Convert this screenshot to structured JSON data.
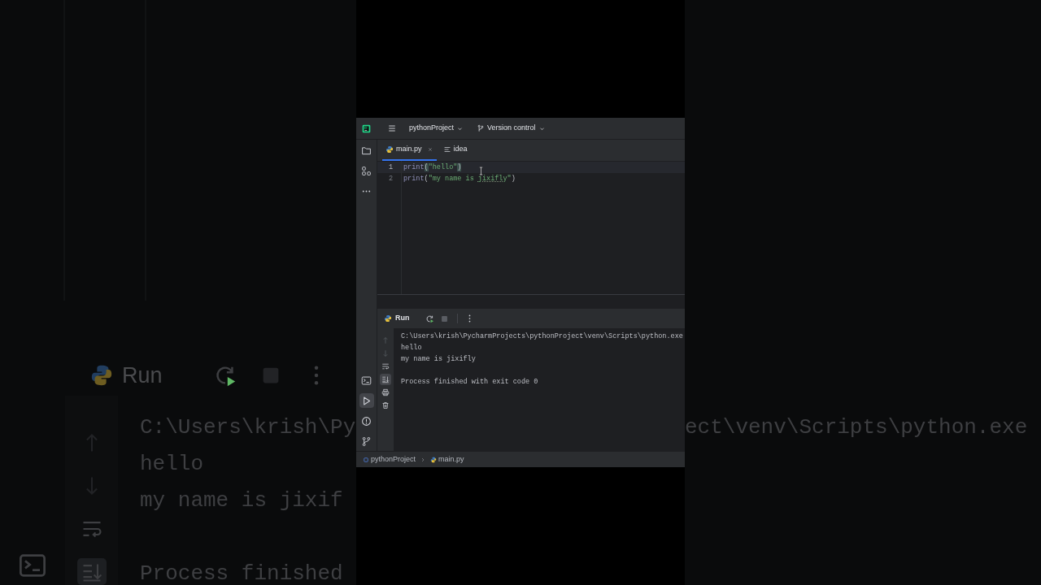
{
  "backdrop": {
    "left": {
      "toolbar": {
        "title": "Run",
        "actions": [
          {
            "kind": "rerun",
            "disabled": false
          },
          {
            "kind": "stop",
            "disabled": true
          },
          {
            "kind": "more",
            "disabled": false
          }
        ]
      },
      "side_actions": [
        {
          "kind": "up",
          "disabled": true,
          "selected": false
        },
        {
          "kind": "down",
          "disabled": true,
          "selected": false
        },
        {
          "kind": "wrap",
          "disabled": false,
          "selected": false
        },
        {
          "kind": "scroll_end",
          "disabled": false,
          "selected": true
        }
      ],
      "tool_strip": [
        {
          "kind": "terminal",
          "selected": false
        }
      ],
      "console_blocks": [
        [
          "C:\\Users\\krish\\Py",
          "hello",
          "my name is jixif"
        ],
        [
          "Process finished"
        ]
      ]
    },
    "right": {
      "console_blocks": [
        [
          "ect\\venv\\Scripts\\python.exe"
        ]
      ]
    }
  },
  "title_bar": {
    "project": "pythonProject",
    "vcs": "Version control"
  },
  "tool_strip": {
    "top": [
      {
        "kind": "folder",
        "selected": false
      },
      {
        "kind": "structure",
        "selected": false
      },
      {
        "kind": "more",
        "selected": false
      }
    ],
    "bottom": [
      {
        "kind": "terminal",
        "selected": false
      },
      {
        "kind": "run",
        "selected": true
      },
      {
        "kind": "problems",
        "selected": false
      },
      {
        "kind": "git",
        "selected": false
      }
    ]
  },
  "editor_tabs": [
    {
      "label": "main.py",
      "kind": "python",
      "selected": true
    },
    {
      "label": "idea",
      "kind": "list",
      "selected": false
    }
  ],
  "editor_lines": [
    {
      "number": "1",
      "current": true,
      "tokens": [
        {
          "text": "print",
          "kind": "function"
        },
        {
          "text": "(",
          "kind": "paren_match"
        },
        {
          "text": "\"hello\"",
          "kind": "string"
        },
        {
          "text": ")",
          "kind": "paren_match"
        }
      ]
    },
    {
      "number": "2",
      "current": false,
      "tokens": [
        {
          "text": "print",
          "kind": "function"
        },
        {
          "text": "(",
          "kind": "paren"
        },
        {
          "text": "\"my name is ",
          "kind": "string"
        },
        {
          "text": "jixifly",
          "kind": "string_typo"
        },
        {
          "text": "\"",
          "kind": "string"
        },
        {
          "text": ")",
          "kind": "paren"
        }
      ]
    }
  ],
  "run_panel": {
    "title": "Run",
    "actions": [
      {
        "kind": "rerun",
        "disabled": false
      },
      {
        "kind": "stop",
        "disabled": true
      },
      {
        "kind": "more",
        "disabled": false
      }
    ],
    "side_actions": [
      {
        "kind": "up",
        "disabled": true,
        "selected": false
      },
      {
        "kind": "down",
        "disabled": true,
        "selected": false
      },
      {
        "kind": "wrap",
        "disabled": false,
        "selected": false
      },
      {
        "kind": "scroll_end",
        "disabled": false,
        "selected": true
      },
      {
        "kind": "print",
        "disabled": false,
        "selected": false
      },
      {
        "kind": "trash",
        "disabled": false,
        "selected": false
      }
    ],
    "console_blocks": [
      [
        "C:\\Users\\krish\\PycharmProjects\\pythonProject\\venv\\Scripts\\python.exe",
        "hello",
        "my name is jixifly"
      ],
      [
        "Process finished with exit code 0"
      ]
    ]
  },
  "breadcrumbs": [
    {
      "label": "pythonProject",
      "kind": "module"
    },
    {
      "label": "main.py",
      "kind": "python"
    }
  ]
}
